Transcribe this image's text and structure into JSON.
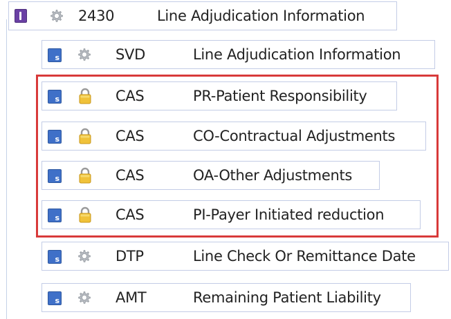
{
  "loop": {
    "number": "2430",
    "description": "Line Adjudication Information",
    "icon": "loop-icon",
    "status_icon": "gear-icon"
  },
  "segments": [
    {
      "code": "SVD",
      "description": "Line Adjudication Information",
      "icon": "segment-s-icon",
      "status_icon": "gear-icon"
    },
    {
      "code": "CAS",
      "description": "PR-Patient Responsibility",
      "icon": "segment-s-icon",
      "status_icon": "lock-icon"
    },
    {
      "code": "CAS",
      "description": "CO-Contractual Adjustments",
      "icon": "segment-s-icon",
      "status_icon": "lock-icon"
    },
    {
      "code": "CAS",
      "description": "OA-Other Adjustments",
      "icon": "segment-s-icon",
      "status_icon": "lock-icon"
    },
    {
      "code": "CAS",
      "description": "PI-Payer Initiated reduction",
      "icon": "segment-s-icon",
      "status_icon": "lock-icon"
    },
    {
      "code": "DTP",
      "description": "Line Check Or Remittance Date",
      "icon": "segment-s-icon",
      "status_icon": "gear-icon"
    },
    {
      "code": "AMT",
      "description": "Remaining Patient Liability",
      "icon": "segment-s-icon",
      "status_icon": "gear-icon"
    }
  ],
  "colors": {
    "highlight_border": "#d83a3a",
    "segment_icon": "#3f70c8",
    "loop_icon": "#6a40a4",
    "lock_body": "#f0c23a",
    "row_border": "#c3cce6"
  }
}
